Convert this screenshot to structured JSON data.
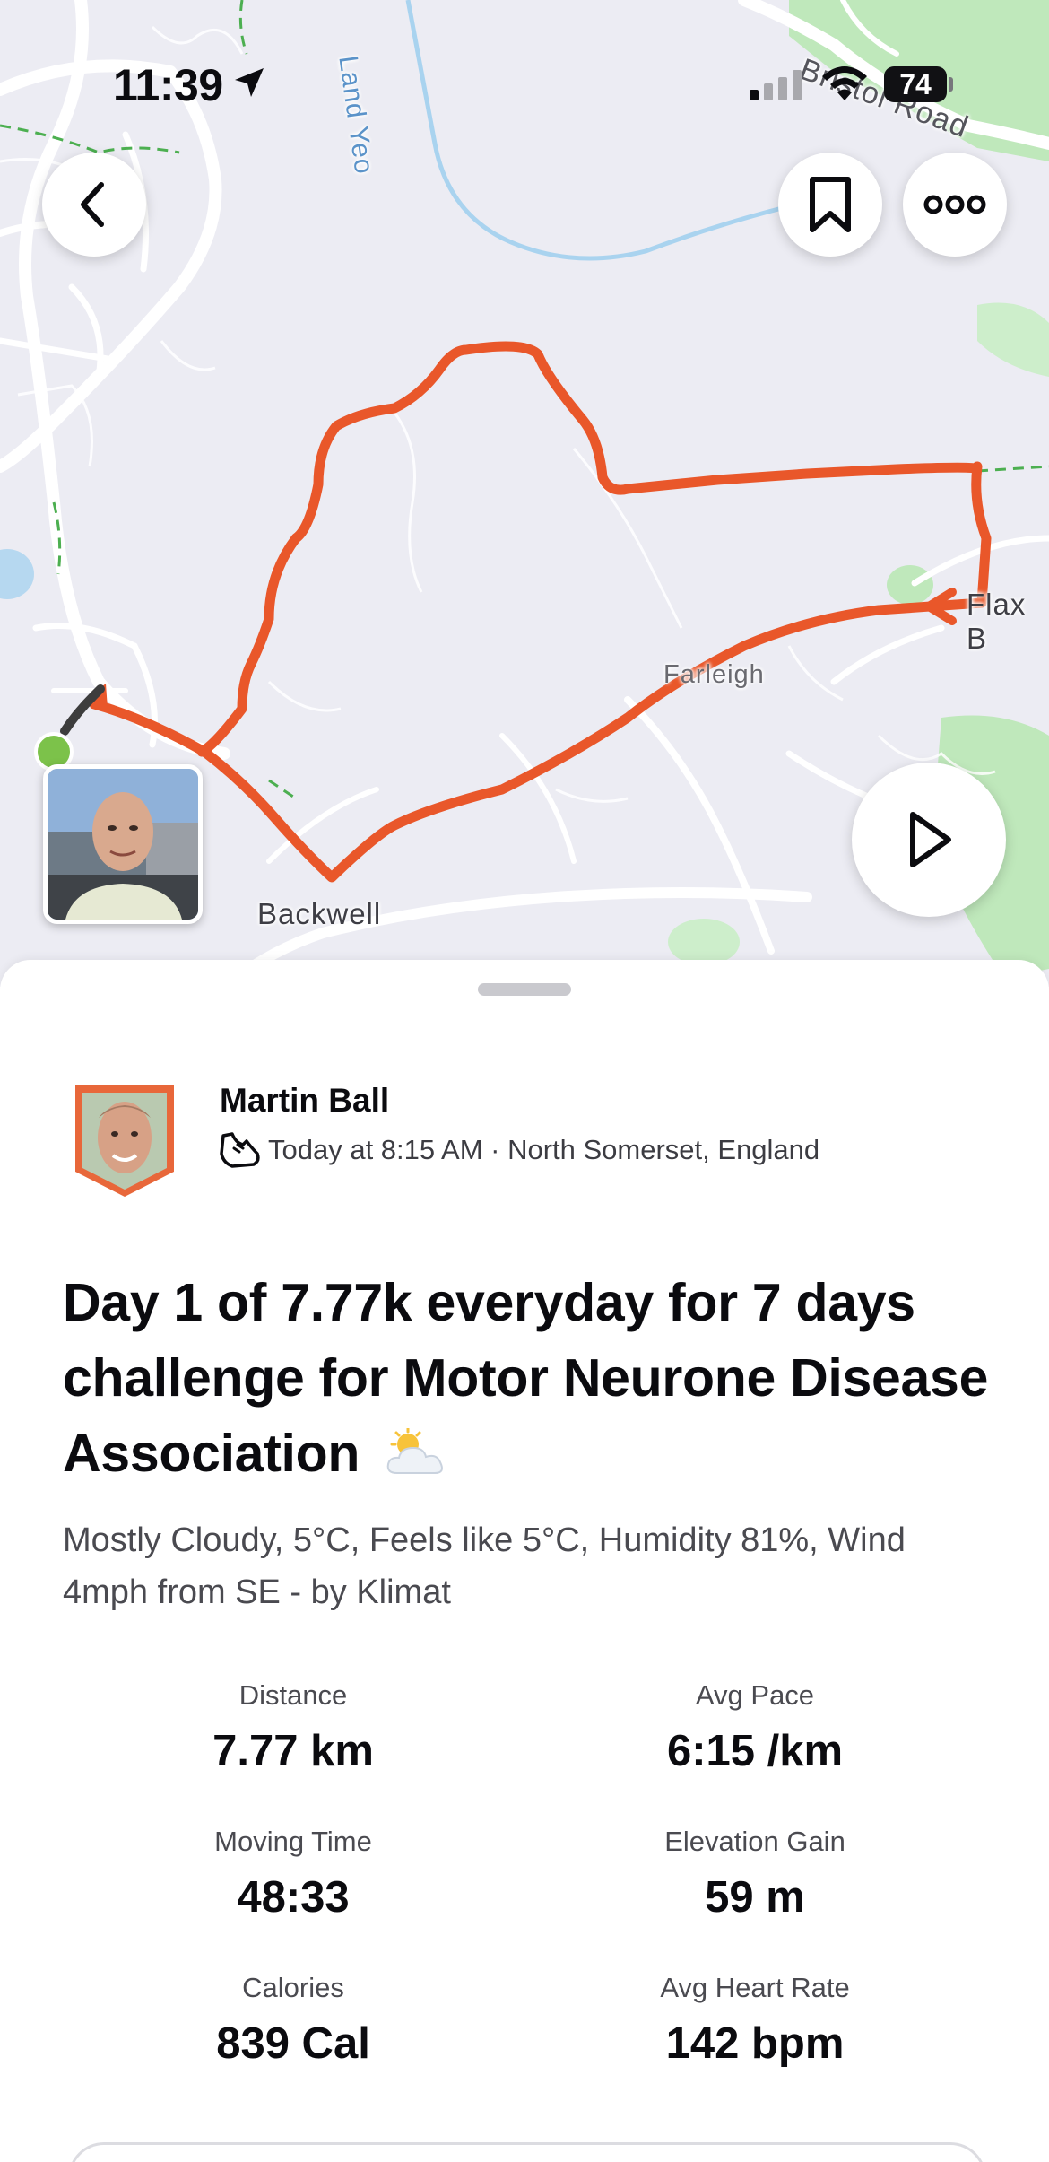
{
  "status_bar": {
    "time": "11:39",
    "battery": "74"
  },
  "map": {
    "labels": {
      "river": "Land Yeo",
      "road": "Bristol Road",
      "town": "Backwell",
      "village": "Farleigh",
      "place": "Flax B"
    },
    "route_color": "#E9572A",
    "start_color": "#7CC24A"
  },
  "map_controls": {
    "back": "chevron-left-icon",
    "save": "bookmark-icon",
    "more": "more-horizontal-icon",
    "play": "play-icon"
  },
  "athlete": {
    "name": "Martin Ball",
    "meta": "Today at 8:15 AM · North Somerset, England"
  },
  "activity": {
    "title": "Day 1 of 7.77k everyday for 7 days challenge for Motor Neurone Disease Association",
    "title_emoji": "sun-behind-cloud-icon",
    "description": "Mostly Cloudy, 5°C, Feels like 5°C, Humidity 81%, Wind 4mph from SE - by Klimat"
  },
  "stats": [
    {
      "label": "Distance",
      "value": "7.77 km"
    },
    {
      "label": "Avg Pace",
      "value": "6:15 /km"
    },
    {
      "label": "Moving Time",
      "value": "48:33"
    },
    {
      "label": "Elevation Gain",
      "value": "59 m"
    },
    {
      "label": "Calories",
      "value": "839 Cal"
    },
    {
      "label": "Avg Heart Rate",
      "value": "142 bpm"
    }
  ],
  "colors": {
    "accent": "#FC5200",
    "route": "#E9572A",
    "map_bg": "#ECECF3",
    "park": "#B9E6B5"
  }
}
